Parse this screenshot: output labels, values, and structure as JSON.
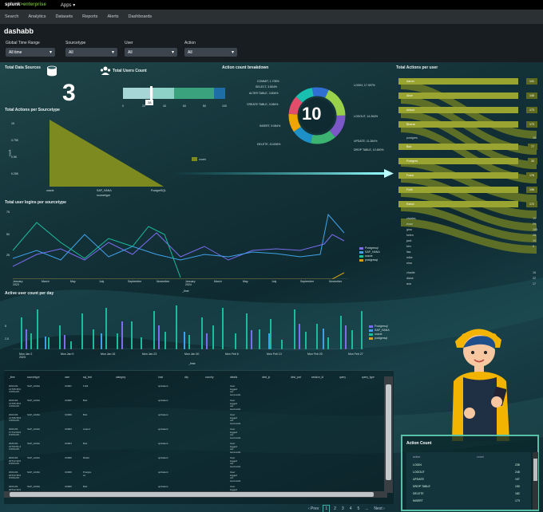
{
  "topbar": {
    "logo_a": "splunk",
    "logo_b": ">enterprise",
    "apps": "Apps ▾"
  },
  "nav": [
    "Search",
    "Analytics",
    "Datasets",
    "Reports",
    "Alerts",
    "Dashboards"
  ],
  "title": "dashabb",
  "filters": [
    {
      "label": "Global Time Range",
      "value": "All time"
    },
    {
      "label": "Sourcetype",
      "value": "All"
    },
    {
      "label": "User",
      "value": "All"
    },
    {
      "label": "Action",
      "value": "All"
    }
  ],
  "panels": {
    "total_sources": {
      "title": "Total Data Sources",
      "value": "3"
    },
    "users_count": {
      "title": "Total Users Count",
      "marker": "28",
      "ticks": [
        "0",
        "20",
        "40",
        "60",
        "80",
        "100"
      ]
    },
    "action_breakdown": {
      "title": "Action count breakdown",
      "center": "10",
      "labels": [
        "COMMIT, 1.705%",
        "SELECT, 3.804%",
        "ALTER TABLE, 3.804%",
        "CREATE TABLE, 3.084%",
        "INSERT, 9.084%",
        "DELETE, 10.636%",
        "LOGIN, 17.097%",
        "LOGOUT, 14.264%",
        "UPDATE, 11.264%",
        "DROP TABLE, 10.690%"
      ]
    },
    "actions_sourcetype": {
      "title": "Total Actions per Sourcetype",
      "ylabel": "count",
      "xlabel": "sourcetype",
      "legend": "count",
      "yticks": [
        "1K",
        "0.75K",
        "0.5K",
        "0.25K"
      ],
      "categories": [
        "oracle",
        "SAP_HANA",
        "PostgreSQL"
      ]
    },
    "actions_user": {
      "title": "Total Actions per user"
    },
    "logins_sourcetype": {
      "title": "Total user logins per sourcetype",
      "xlabel": "_time",
      "yticks": [
        "75",
        "50",
        "25"
      ],
      "xticks": [
        "January\n2023",
        "March",
        "May",
        "July",
        "September",
        "November",
        "January\n2024",
        "March",
        "May",
        "July",
        "September",
        "November"
      ],
      "legend": [
        "Postgresql",
        "SAP_HANA",
        "oracle",
        "postgresql"
      ]
    },
    "active_users": {
      "title": "Active user count per day",
      "xlabel": "_time",
      "yticks": [
        "5",
        "2.5"
      ],
      "xticks": [
        "Mon Jan 2\n2023",
        "Mon Jan 9",
        "Mon Jan 16",
        "Mon Jan 23",
        "Mon Jan 30",
        "Mon Feb 6",
        "Mon Feb 13",
        "Mon Feb 20",
        "Mon Feb 27"
      ],
      "legend": [
        "Postgresql",
        "SAP_HANA",
        "oracle",
        "postgresql"
      ]
    },
    "action_count": {
      "title": "Action Count",
      "col1": "action",
      "col2": "count",
      "rows": [
        [
          "LOGIN",
          "238"
        ],
        [
          "LOGOUT",
          "248"
        ],
        [
          "UPDATE",
          "197"
        ],
        [
          "DROP TABLE",
          "190"
        ],
        [
          "DELETE",
          "182"
        ],
        [
          "INSERT",
          "173"
        ]
      ]
    }
  },
  "sankey": [
    {
      "user": "Aaron",
      "v": "141"
    },
    {
      "user": "Alice",
      "v": "145"
    },
    {
      "user": "Antoni",
      "v": "173"
    },
    {
      "user": "Bharat",
      "v": "173"
    },
    {
      "user": "postgres",
      "v": "28",
      "plain": true
    },
    {
      "user": "Bob",
      "v": "77"
    },
    {
      "user": "Postgres",
      "v": "33"
    },
    {
      "user": "Frank",
      "v": "176"
    },
    {
      "user": "Fulill",
      "v": "196"
    },
    {
      "user": "Rahul",
      "v": "172"
    },
    {
      "user": "charles",
      "v": "19",
      "plain": true
    },
    {
      "user": "evan",
      "v": "29",
      "plain": true
    },
    {
      "user": "gina",
      "v": "189",
      "plain": true
    },
    {
      "user": "helen",
      "v": "28",
      "plain": true
    },
    {
      "user": "jack",
      "v": "19",
      "plain": true
    },
    {
      "user": "kim",
      "v": "6",
      "plain": true
    },
    {
      "user": "lisa",
      "v": "",
      "plain": true
    },
    {
      "user": "mike",
      "v": "",
      "plain": true
    },
    {
      "user": "nina",
      "v": "",
      "plain": true
    },
    {
      "user": "charlie",
      "v": "15",
      "plain": true
    },
    {
      "user": "diane",
      "v": "22",
      "plain": true
    },
    {
      "user": "ava",
      "v": "17",
      "plain": true
    }
  ],
  "table": {
    "headers": [
      "_time",
      "sourcetype",
      "user",
      "sql_text",
      "category",
      "host",
      "city",
      "country",
      "details",
      "dest_ip",
      "dest_port",
      "session_id",
      "query",
      "query_type"
    ],
    "rows": [
      [
        "2023-06-\n14T05:35:0\n4.000+00:",
        "SAP_HANA",
        "U0001",
        "Fulill",
        "",
        "spilvalent",
        "",
        "",
        "User\nlogged\nout\nsuccessfu"
      ],
      [
        "2023-06-\n14T05:35:0\n4.000+00:",
        "SAP_HANA",
        "U0006",
        "Bob",
        "",
        "spilvalent",
        "",
        "",
        "User\nlogged\nout\nsuccessfu"
      ],
      [
        "2023-06-\n14T05:35:0\n4.000+00:",
        "SAP_HANA",
        "U0006",
        "Bob",
        "",
        "spilvalent",
        "",
        "",
        "User\nlogged\nout\nsuccessfu"
      ],
      [
        "2023-06-\n17T12:00:0\n0.000+00:",
        "SAP_HANA",
        "U0003",
        "Anand",
        "",
        "spilvalent",
        "",
        "",
        "User\nlogged\nout\nsuccessfu"
      ],
      [
        "2023-06-\n21T04:51:4\n3.000+00:",
        "SAP_HANA",
        "U0004",
        "Bob",
        "",
        "spilvalent",
        "",
        "",
        "User\nlogged\nout\nsuccessfu"
      ],
      [
        "2023-06-\n20T12:30:0\n0.000+00:",
        "SAP_HANA",
        "U0009",
        "Rahul",
        "",
        "spilvalent",
        "",
        "",
        "User\nlogged\nout\nsuccessfu"
      ],
      [
        "2023-06-\n20T12:35:0\n0.000+00:",
        "SAP_HANA",
        "U0009",
        "Postgre\nss",
        "",
        "spilvalent",
        "",
        "",
        "User\nlogged\nout\nsuccessfu"
      ],
      [
        "2023-06-\n20T12:40:0\n0.000+00:",
        "SAP_HANA",
        "U0009",
        "Bob",
        "",
        "spilvalent",
        "",
        "",
        "User\nlogged\nout"
      ]
    ]
  },
  "pager": [
    "‹ Prev",
    "1",
    "2",
    "3",
    "4",
    "5",
    "...",
    "Next ›"
  ]
}
